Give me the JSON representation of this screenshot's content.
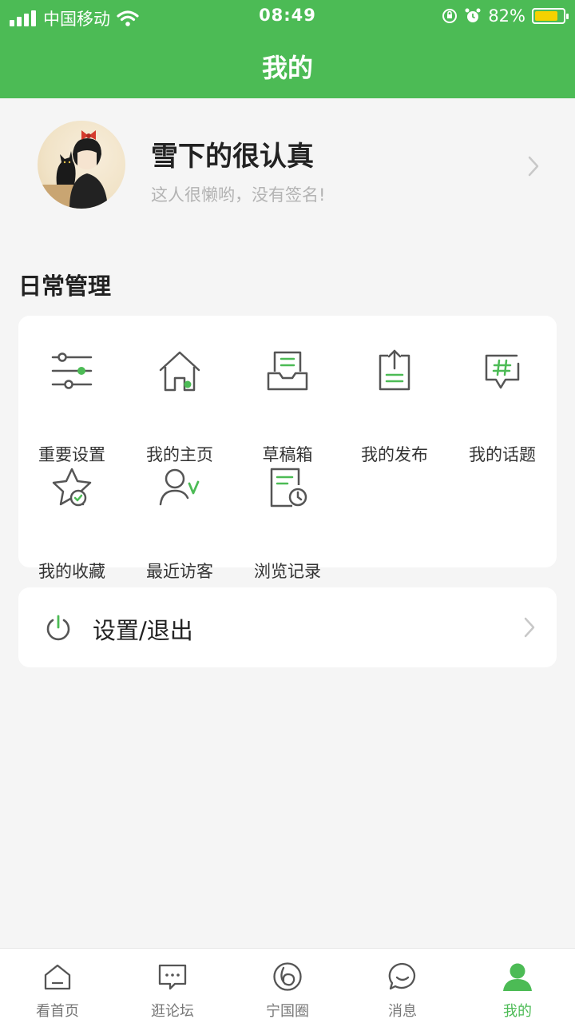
{
  "status_bar": {
    "carrier": "中国移动",
    "time": "08:49",
    "battery_percent": "82%",
    "battery_level": 0.82
  },
  "header": {
    "title": "我的"
  },
  "profile": {
    "name": "雪下的很认真",
    "signature": "这人很懒哟，没有签名!"
  },
  "daily": {
    "title": "日常管理",
    "items": [
      {
        "label": "重要设置",
        "icon": "sliders-icon"
      },
      {
        "label": "我的主页",
        "icon": "home-icon"
      },
      {
        "label": "草稿箱",
        "icon": "drafts-icon"
      },
      {
        "label": "我的发布",
        "icon": "publish-icon"
      },
      {
        "label": "我的话题",
        "icon": "topic-icon"
      },
      {
        "label": "我的收藏",
        "icon": "favorite-icon"
      },
      {
        "label": "最近访客",
        "icon": "visitor-icon"
      },
      {
        "label": "浏览记录",
        "icon": "history-icon"
      }
    ]
  },
  "settings": {
    "label": "设置/退出"
  },
  "tabs": [
    {
      "label": "看首页",
      "icon": "home-tab-icon"
    },
    {
      "label": "逛论坛",
      "icon": "forum-icon"
    },
    {
      "label": "宁国圈",
      "icon": "circle-icon"
    },
    {
      "label": "消息",
      "icon": "message-icon"
    },
    {
      "label": "我的",
      "icon": "user-icon",
      "active": true
    }
  ],
  "colors": {
    "brand_green": "#4cbb55",
    "background": "#f5f5f5",
    "battery_yellow": "#f5d200"
  }
}
